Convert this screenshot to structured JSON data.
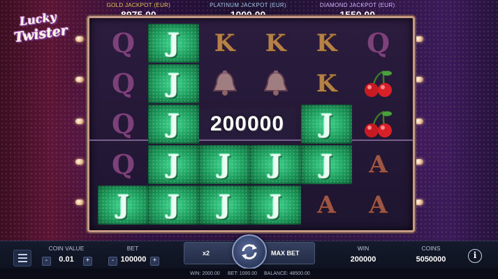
{
  "game": {
    "logo_line1": "Lucky",
    "logo_line2": "Twister"
  },
  "jackpots": [
    {
      "label": "GOLD JACKPOT (EUR)",
      "value": "8975.00"
    },
    {
      "label": "PLATINUM JACKPOT (EUR)",
      "value": "1000.00"
    },
    {
      "label": "DIAMOND JACKPOT (EUR)",
      "value": "1550.00"
    }
  ],
  "reels": {
    "rows": [
      [
        "Q",
        "J",
        "K",
        "K",
        "K",
        "Q"
      ],
      [
        "Q",
        "J",
        "bell",
        "bell",
        "K",
        "cherry"
      ],
      [
        "Q",
        "J",
        "",
        "",
        "J",
        "cherry"
      ],
      [
        "Q",
        "J",
        "J",
        "J",
        "J",
        "A"
      ],
      [
        "J",
        "J",
        "J",
        "J",
        "A",
        "A"
      ]
    ],
    "win_amount": "200000"
  },
  "controls": {
    "coin_value_label": "COIN VALUE",
    "coin_value": "0.01",
    "bet_label": "BET",
    "bet": "100000",
    "minus": "-",
    "plus": "+",
    "x2_label": "x2",
    "max_bet_label": "MAX BET",
    "win_label": "WIN",
    "win": "200000",
    "coins_label": "COINS",
    "coins": "5050000",
    "info": "i"
  },
  "status": {
    "win": "WIN: 2000.00",
    "bet": "BET: 1000.00",
    "balance": "BALANCE: 48500.00"
  },
  "colors": {
    "win_highlight": "#1c9c5c",
    "frame": "#c79a86",
    "bar": "#151b2c"
  }
}
